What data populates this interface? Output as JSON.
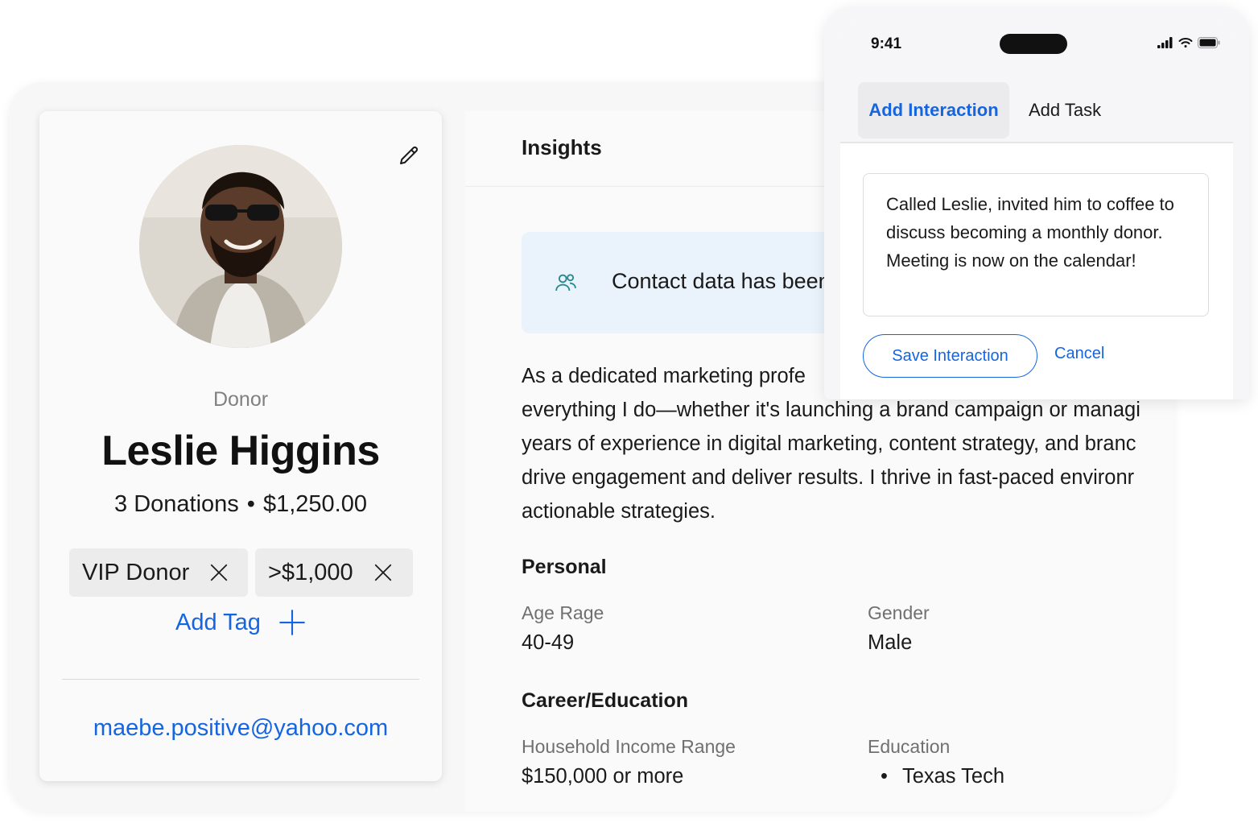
{
  "profile": {
    "role": "Donor",
    "name": "Leslie Higgins",
    "donation_count": "3 Donations",
    "separator": "•",
    "donation_total": "$1,250.00",
    "tags": [
      "VIP Donor",
      ">$1,000"
    ],
    "add_tag_label": "Add Tag",
    "email": "maebe.positive@yahoo.com"
  },
  "insights": {
    "title": "Insights",
    "notice": "Contact data has been",
    "bio_lines": [
      "As a dedicated marketing profe",
      "everything I do—whether it's launching a brand campaign or managi",
      "years of experience in digital marketing, content strategy, and branc",
      "drive engagement and deliver results. I thrive in fast-paced environr",
      "actionable strategies."
    ],
    "personal": {
      "title": "Personal",
      "age_label": "Age Rage",
      "age_value": "40-49",
      "gender_label": "Gender",
      "gender_value": "Male"
    },
    "career": {
      "title": "Career/Education",
      "income_label": "Household Income Range",
      "income_value": "$150,000 or more",
      "education_label": "Education",
      "education_value": "Texas Tech"
    }
  },
  "phone": {
    "time": "9:41",
    "tabs": [
      "Add Interaction",
      "Add Task"
    ],
    "note": "Called Leslie, invited him to coffee to discuss becoming a monthly donor. Meeting is now on the calendar!",
    "save_label": "Save Interaction",
    "cancel_label": "Cancel"
  },
  "colors": {
    "accent": "#1565e0",
    "notice_bg": "#eaf2fb",
    "icon_teal": "#2a8a8e"
  },
  "icons": [
    "pencil-icon",
    "close-icon",
    "plus-icon",
    "people-icon",
    "signal-icon",
    "wifi-icon",
    "battery-icon"
  ]
}
